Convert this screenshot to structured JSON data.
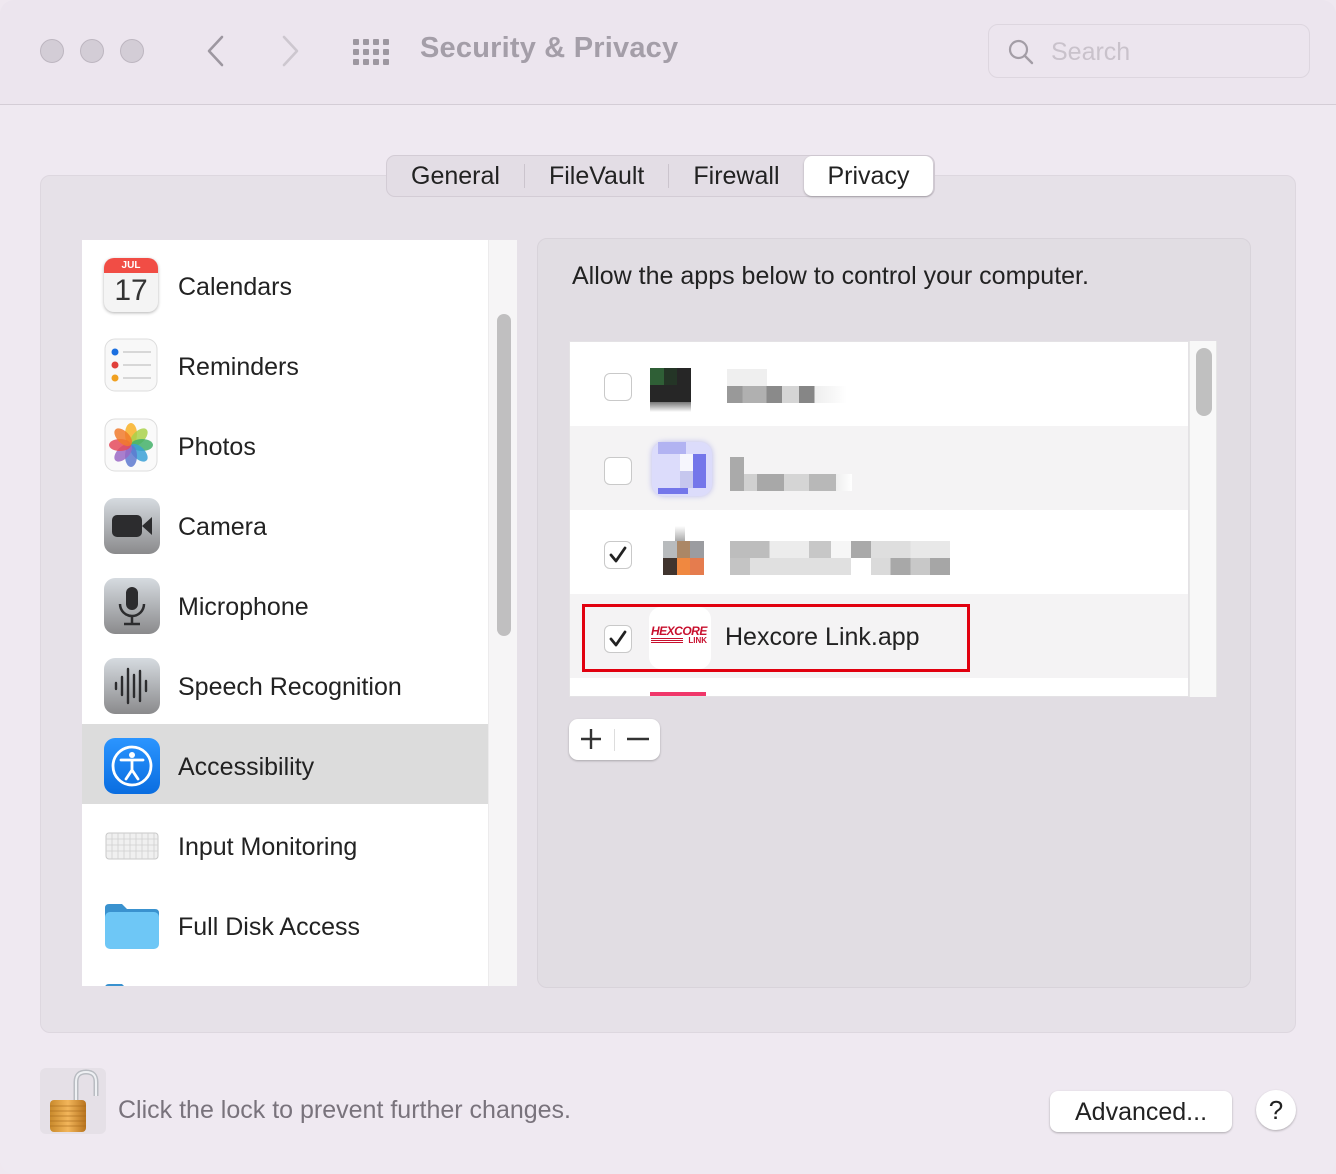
{
  "window": {
    "title": "Security & Privacy",
    "search": {
      "placeholder": "Search",
      "value": ""
    }
  },
  "tabs": [
    {
      "label": "General",
      "active": false
    },
    {
      "label": "FileVault",
      "active": false
    },
    {
      "label": "Firewall",
      "active": false
    },
    {
      "label": "Privacy",
      "active": true
    }
  ],
  "sidebar": {
    "items": [
      {
        "label": "Calendars",
        "icon": "calendar-icon",
        "calendar_month": "JUL",
        "calendar_day": "17",
        "selected": false
      },
      {
        "label": "Reminders",
        "icon": "reminders-icon",
        "selected": false
      },
      {
        "label": "Photos",
        "icon": "photos-icon",
        "selected": false
      },
      {
        "label": "Camera",
        "icon": "camera-icon",
        "selected": false
      },
      {
        "label": "Microphone",
        "icon": "microphone-icon",
        "selected": false
      },
      {
        "label": "Speech Recognition",
        "icon": "speech-recognition-icon",
        "selected": false
      },
      {
        "label": "Accessibility",
        "icon": "accessibility-icon",
        "selected": true
      },
      {
        "label": "Input Monitoring",
        "icon": "keyboard-icon",
        "selected": false
      },
      {
        "label": "Full Disk Access",
        "icon": "folder-icon",
        "selected": false
      }
    ]
  },
  "panel": {
    "description": "Allow the apps below to control your computer.",
    "apps": [
      {
        "name": "",
        "obscured": true,
        "checked": false
      },
      {
        "name": "",
        "obscured": true,
        "checked": false
      },
      {
        "name": "",
        "obscured": true,
        "checked": true
      },
      {
        "name": "Hexcore Link.app",
        "obscured": false,
        "checked": true,
        "icon_text_top": "HEXCORE",
        "icon_text_bottom": "LINK",
        "highlighted": true
      }
    ],
    "add_label": "+",
    "remove_label": "−",
    "highlight_color": "#e1000f"
  },
  "footer": {
    "lock_text": "Click the lock to prevent further changes.",
    "lock_state": "unlocked",
    "advanced_label": "Advanced...",
    "help_label": "?"
  },
  "colors": {
    "accent": "#1a7cf5",
    "selected_row": "#dcdcdc"
  }
}
